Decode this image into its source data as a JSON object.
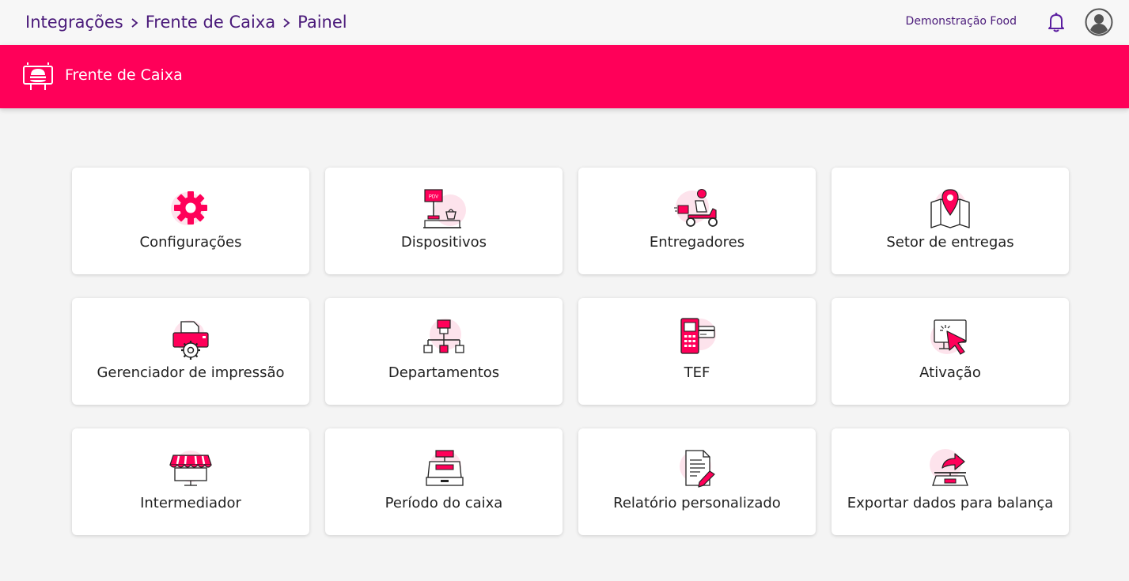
{
  "breadcrumb": [
    {
      "label": "Integrações"
    },
    {
      "label": "Frente de Caixa"
    },
    {
      "label": "Painel"
    }
  ],
  "header": {
    "company": "Demonstração Food",
    "bell_icon": "bell-icon",
    "avatar_icon": "user-avatar-icon"
  },
  "banner": {
    "title": "Frente de Caixa",
    "icon": "pos-display-icon",
    "color": "#ff0059"
  },
  "colors": {
    "accent": "#ff0059",
    "accent_soft": "#fde3ec",
    "breadcrumb_text": "#4a1a7a"
  },
  "cards": [
    {
      "label": "Configurações",
      "icon": "gear-icon"
    },
    {
      "label": "Dispositivos",
      "icon": "pdv-device-icon"
    },
    {
      "label": "Entregadores",
      "icon": "delivery-scooter-icon"
    },
    {
      "label": "Setor de entregas",
      "icon": "map-pin-icon"
    },
    {
      "label": "Gerenciador de impressão",
      "icon": "printer-settings-icon"
    },
    {
      "label": "Departamentos",
      "icon": "org-chart-icon"
    },
    {
      "label": "TEF",
      "icon": "card-terminal-icon"
    },
    {
      "label": "Ativação",
      "icon": "cursor-click-icon"
    },
    {
      "label": "Intermediador",
      "icon": "storefront-icon"
    },
    {
      "label": "Período do caixa",
      "icon": "cash-register-icon"
    },
    {
      "label": "Relatório personalizado",
      "icon": "report-edit-icon"
    },
    {
      "label": "Exportar dados para balança",
      "icon": "scale-export-icon"
    }
  ]
}
